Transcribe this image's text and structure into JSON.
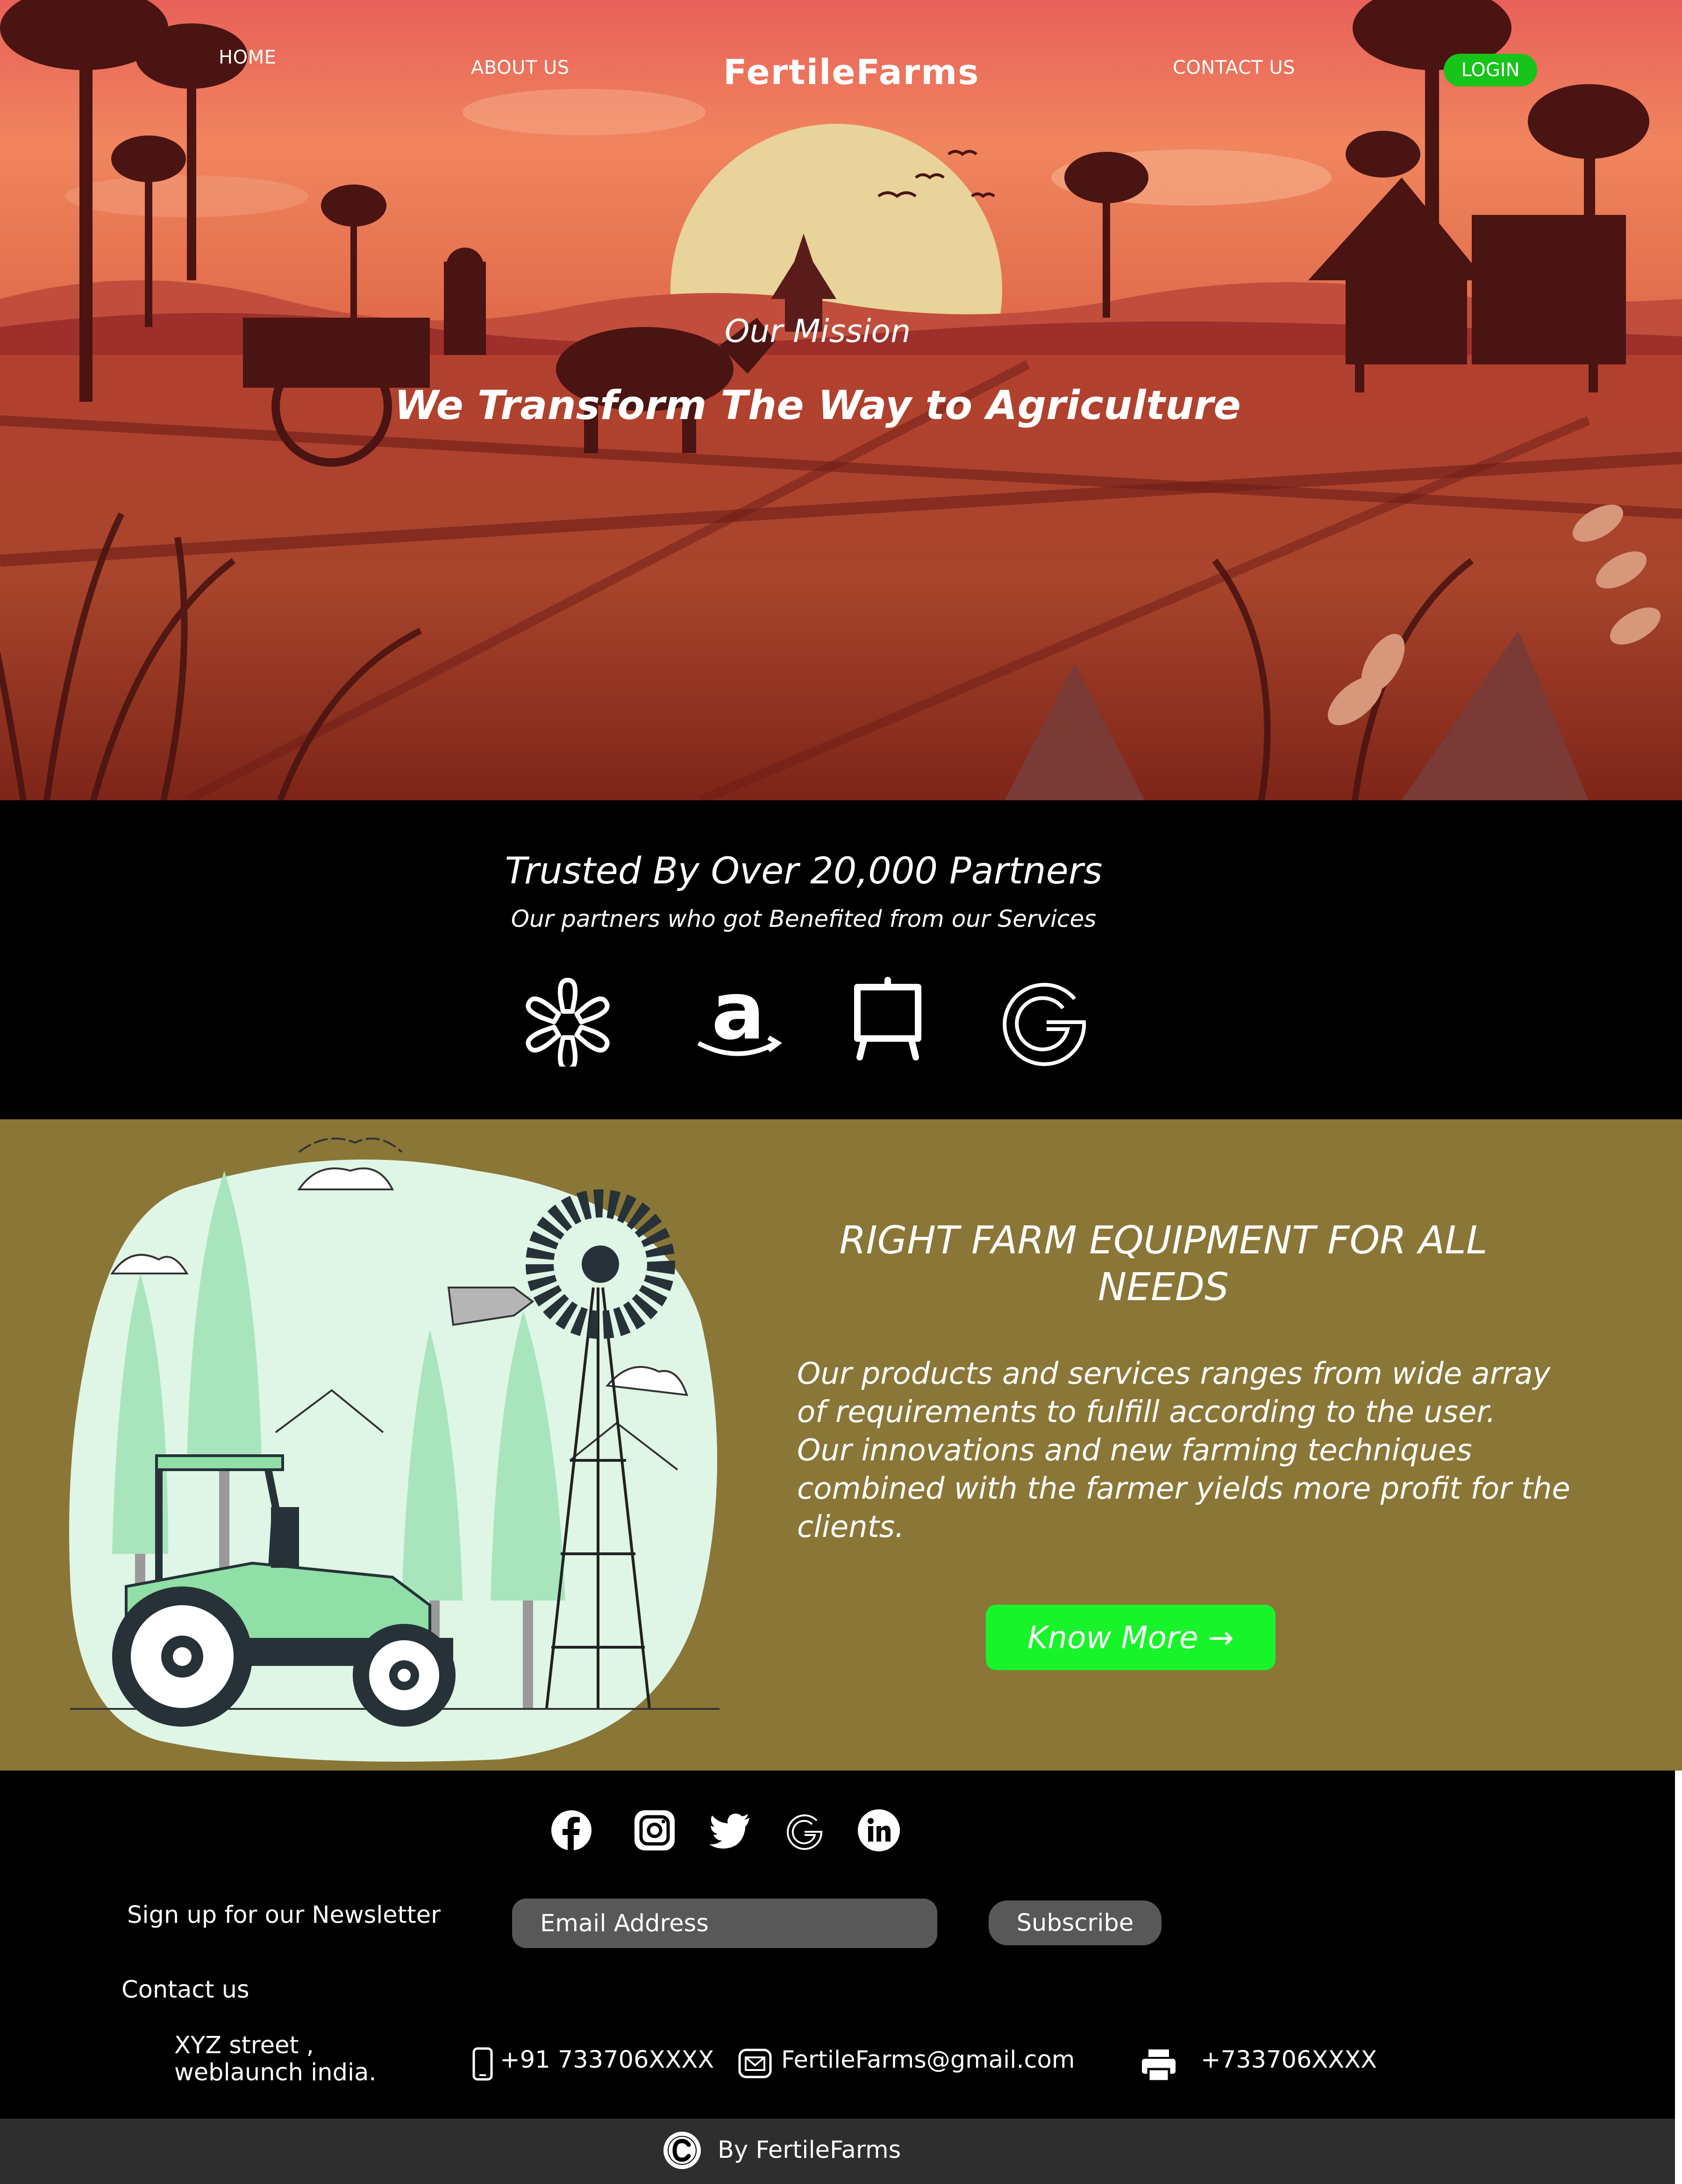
{
  "nav": {
    "home": "HOME",
    "about": "ABOUT US",
    "brand": "FertileFarms",
    "contact": "CONTACT US",
    "login": "LOGIN"
  },
  "hero": {
    "kicker": "Our Mission",
    "headline": "We Transform The Way to Agriculture"
  },
  "partners": {
    "title": "Trusted By Over 20,000 Partners",
    "subtitle": "Our partners who got Benefited from our Services",
    "logos": [
      "walmart-spark-icon",
      "amazon-icon",
      "easel-icon",
      "google-icon"
    ]
  },
  "equipment": {
    "title": "RIGHT FARM EQUIPMENT FOR ALL NEEDS",
    "body_lines": [
      "Our products and services ranges from wide array",
      "of requirements to fulfill according to the user.",
      "Our innovations and new farming techniques",
      "combined with the farmer yields more profit for the",
      "clients."
    ],
    "cta": "Know More →"
  },
  "footer": {
    "social": [
      "facebook-icon",
      "instagram-icon",
      "twitter-icon",
      "google-icon",
      "linkedin-icon"
    ],
    "newsletter_label": "Sign up for our Newsletter",
    "email_placeholder": "Email Address",
    "subscribe": "Subscribe",
    "contact_label": "Contact us",
    "address_line1": "XYZ street ,",
    "address_line2": "weblaunch india.",
    "phone": "+91 733706XXXX",
    "email": "FertileFarms@gmail.com",
    "fax": "+733706XXXX",
    "copyright": "By FertileFarms"
  },
  "colors": {
    "login_bg": "#17c41a",
    "equip_bg": "#8a7636",
    "cta_bg": "#17f52a",
    "input_bg": "#585858",
    "copy_bar": "#2e2e2e"
  }
}
